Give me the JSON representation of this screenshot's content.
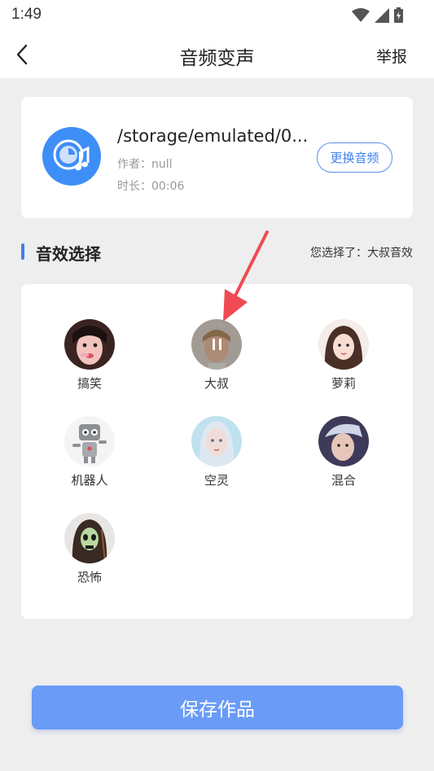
{
  "status_bar": {
    "time": "1:49"
  },
  "nav": {
    "title": "音频变声",
    "report_label": "举报"
  },
  "audio": {
    "path": "/storage/emulated/0...",
    "author": "作者：null",
    "duration": "时长：00:06",
    "change_button": "更换音频"
  },
  "effects_section": {
    "title": "音效选择",
    "selected_text": "您选择了：大叔音效",
    "items": [
      {
        "label": "搞笑",
        "icon": "funny-avatar-icon",
        "playing": false
      },
      {
        "label": "大叔",
        "icon": "uncle-avatar-icon",
        "playing": true
      },
      {
        "label": "萝莉",
        "icon": "loli-avatar-icon",
        "playing": false
      },
      {
        "label": "机器人",
        "icon": "robot-avatar-icon",
        "playing": false
      },
      {
        "label": "空灵",
        "icon": "ethereal-avatar-icon",
        "playing": false
      },
      {
        "label": "混合",
        "icon": "mixed-avatar-icon",
        "playing": false
      },
      {
        "label": "恐怖",
        "icon": "horror-avatar-icon",
        "playing": false
      }
    ]
  },
  "save_button": "保存作品",
  "colors": {
    "accent": "#3e7ff0",
    "save_button": "#6a9cf7",
    "arrow": "#f04a55"
  }
}
